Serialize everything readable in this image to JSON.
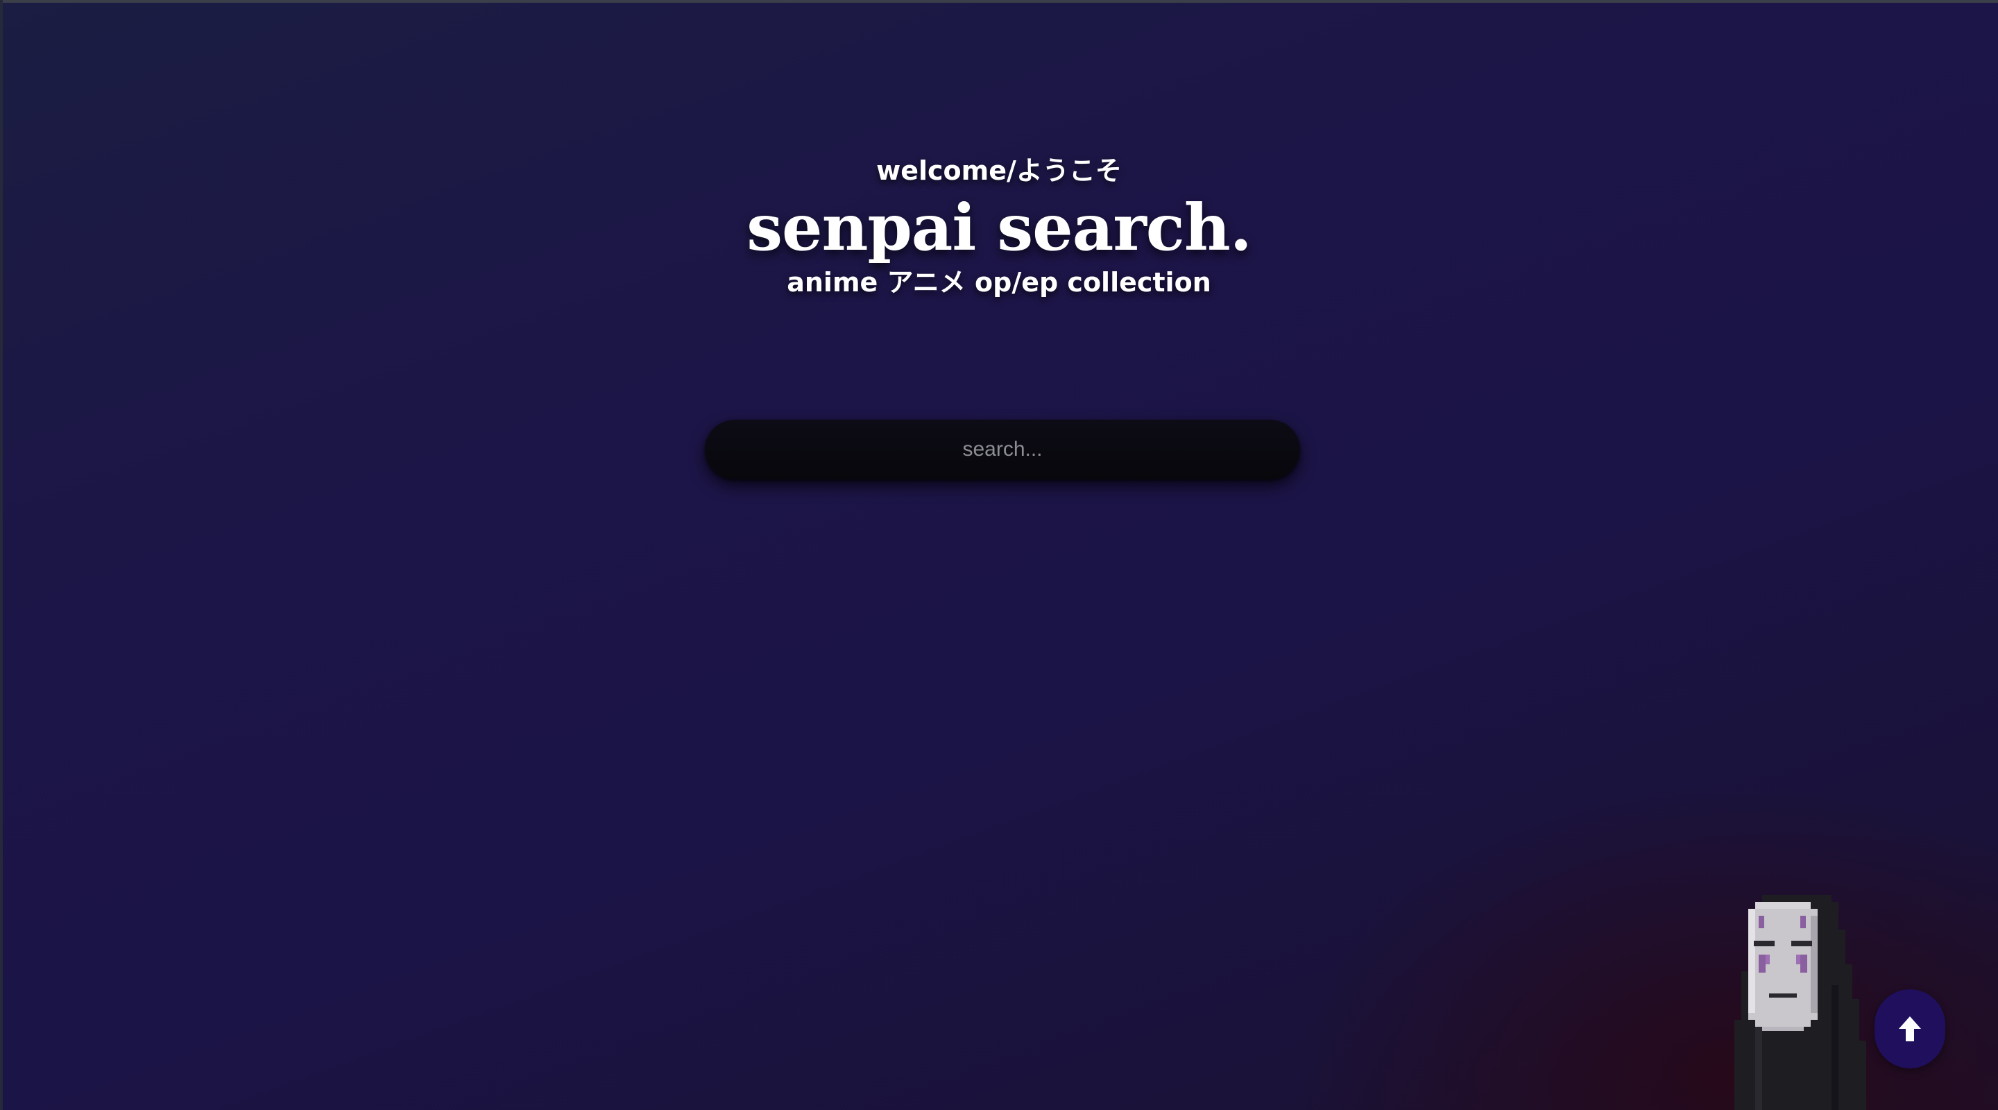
{
  "hero": {
    "welcome": "welcome/ようこそ",
    "title": "senpai search.",
    "subtitle": "anime アニメ op/ep collection"
  },
  "search": {
    "placeholder": "search...",
    "value": ""
  },
  "mascot": {
    "icon": "no-face-pixel-icon"
  },
  "scroll_top": {
    "icon": "arrow-up-icon"
  },
  "colors": {
    "background_top": "#1b1d42",
    "background_mid": "#1c1547",
    "background_bottom": "#1d0f2a",
    "search_bar": "#0a0910",
    "scroll_button": "#1f0f5c",
    "text": "#ffffff"
  }
}
